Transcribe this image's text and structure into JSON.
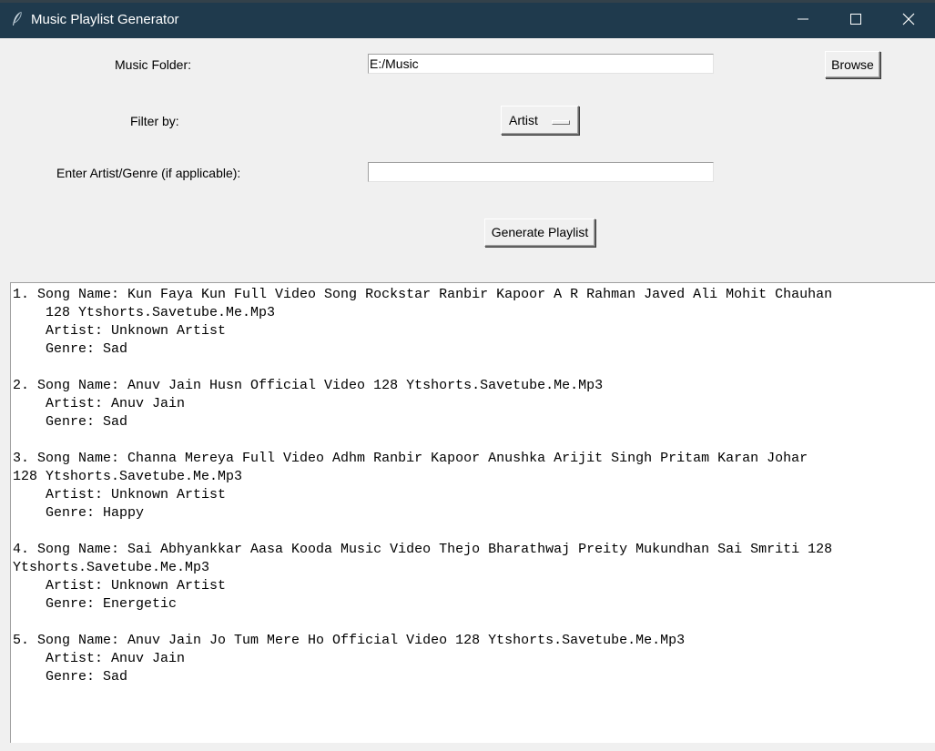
{
  "window": {
    "title": "Music Playlist Generator",
    "colors": {
      "titlebar": "#1f3a4d",
      "background": "#f0f0f0"
    }
  },
  "form": {
    "music_folder_label": "Music Folder:",
    "music_folder_value": "E:/Music",
    "browse_label": "Browse",
    "filter_label": "Filter by:",
    "filter_selected": "Artist",
    "artist_genre_label": "Enter Artist/Genre (if applicable):",
    "artist_genre_value": "",
    "generate_label": "Generate Playlist"
  },
  "output": {
    "lines": [
      "1. Song Name: Kun Faya Kun Full Video Song Rockstar Ranbir Kapoor A R Rahman Javed Ali Mohit Chauhan",
      "    128 Ytshorts.Savetube.Me.Mp3",
      "    Artist: Unknown Artist",
      "    Genre: Sad",
      "",
      "2. Song Name: Anuv Jain Husn Official Video 128 Ytshorts.Savetube.Me.Mp3",
      "    Artist: Anuv Jain",
      "    Genre: Sad",
      "",
      "3. Song Name: Channa Mereya Full Video Adhm Ranbir Kapoor Anushka Arijit Singh Pritam Karan Johar",
      "128 Ytshorts.Savetube.Me.Mp3",
      "    Artist: Unknown Artist",
      "    Genre: Happy",
      "",
      "4. Song Name: Sai Abhyankkar Aasa Kooda Music Video Thejo Bharathwaj Preity Mukundhan Sai Smriti 128",
      "Ytshorts.Savetube.Me.Mp3",
      "    Artist: Unknown Artist",
      "    Genre: Energetic",
      "",
      "5. Song Name: Anuv Jain Jo Tum Mere Ho Official Video 128 Ytshorts.Savetube.Me.Mp3",
      "    Artist: Anuv Jain",
      "    Genre: Sad"
    ]
  },
  "icons": {
    "app": "feather-icon",
    "minimize": "minimize-icon",
    "maximize": "maximize-icon",
    "close": "close-icon"
  }
}
